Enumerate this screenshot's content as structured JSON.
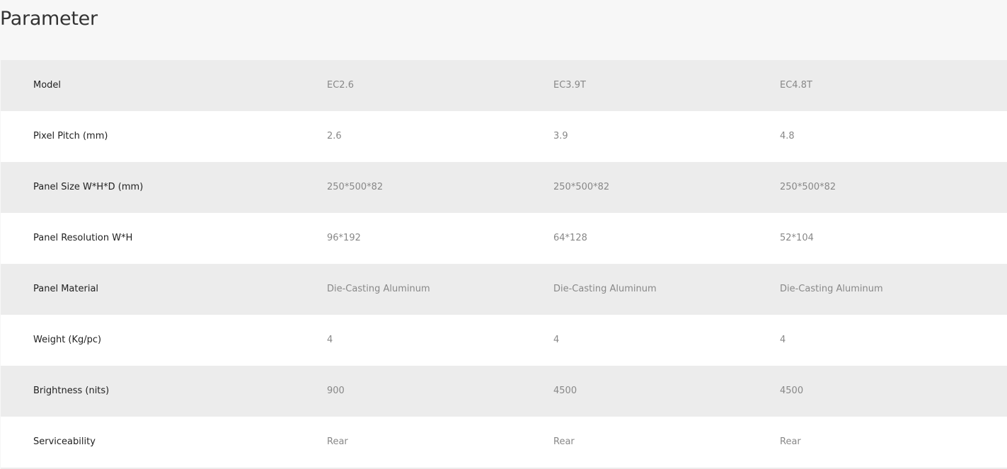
{
  "page": {
    "title": "Parameter"
  },
  "table": {
    "rows": [
      {
        "label": "Model",
        "values": [
          "EC2.6",
          "EC3.9T",
          "EC4.8T"
        ]
      },
      {
        "label": "Pixel Pitch (mm)",
        "values": [
          "2.6",
          "3.9",
          "4.8"
        ]
      },
      {
        "label": "Panel Size W*H*D (mm)",
        "values": [
          "250*500*82",
          "250*500*82",
          "250*500*82"
        ]
      },
      {
        "label": "Panel Resolution W*H",
        "values": [
          "96*192",
          "64*128",
          "52*104"
        ]
      },
      {
        "label": "Panel Material",
        "values": [
          "Die-Casting Aluminum",
          "Die-Casting Aluminum",
          "Die-Casting Aluminum"
        ]
      },
      {
        "label": "Weight (Kg/pc)",
        "values": [
          "4",
          "4",
          "4"
        ]
      },
      {
        "label": "Brightness (nits)",
        "values": [
          "900",
          "4500",
          "4500"
        ]
      },
      {
        "label": "Serviceability",
        "values": [
          "Rear",
          "Rear",
          "Rear"
        ]
      }
    ]
  },
  "colors": {
    "page_background": "#f7f7f7",
    "row_shaded": "#ececec",
    "row_plain": "#ffffff",
    "label_text": "#222222",
    "value_text": "#888888",
    "title_text": "#333333"
  }
}
